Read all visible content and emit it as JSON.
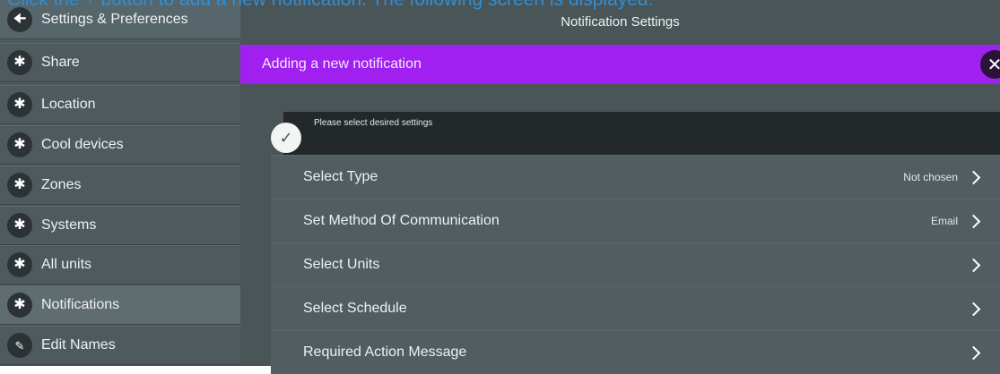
{
  "caption": "Click the + button to add a new notification. The following screen is displayed:",
  "sidebar": {
    "header": {
      "label": "Settings & Preferences",
      "icon": "back-arrow-icon"
    },
    "items": [
      {
        "label": "Share",
        "icon": "asterisk-icon"
      },
      {
        "label": "Location",
        "icon": "asterisk-icon"
      },
      {
        "label": "Cool devices",
        "icon": "asterisk-icon"
      },
      {
        "label": "Zones",
        "icon": "asterisk-icon"
      },
      {
        "label": "Systems",
        "icon": "asterisk-icon"
      },
      {
        "label": "All units",
        "icon": "asterisk-icon"
      },
      {
        "label": "Notifications",
        "icon": "asterisk-icon",
        "active": true
      },
      {
        "label": "Edit Names",
        "icon": "pencil-icon"
      }
    ]
  },
  "main": {
    "title": "Notification Settings",
    "banner": {
      "text": "Adding a new notification",
      "close_icon": "close-icon"
    },
    "prompt": "Please select desired settings",
    "rows": [
      {
        "label": "Select Type",
        "value": "Not chosen"
      },
      {
        "label": "Set Method Of Communication",
        "value": "Email"
      },
      {
        "label": "Select Units",
        "value": ""
      },
      {
        "label": "Select Schedule",
        "value": ""
      },
      {
        "label": "Required Action Message",
        "value": ""
      }
    ]
  },
  "colors": {
    "banner": "#a020f0",
    "sidebar": "#4f5a5e",
    "main": "#4a5558",
    "caption": "#2f8fd6"
  }
}
